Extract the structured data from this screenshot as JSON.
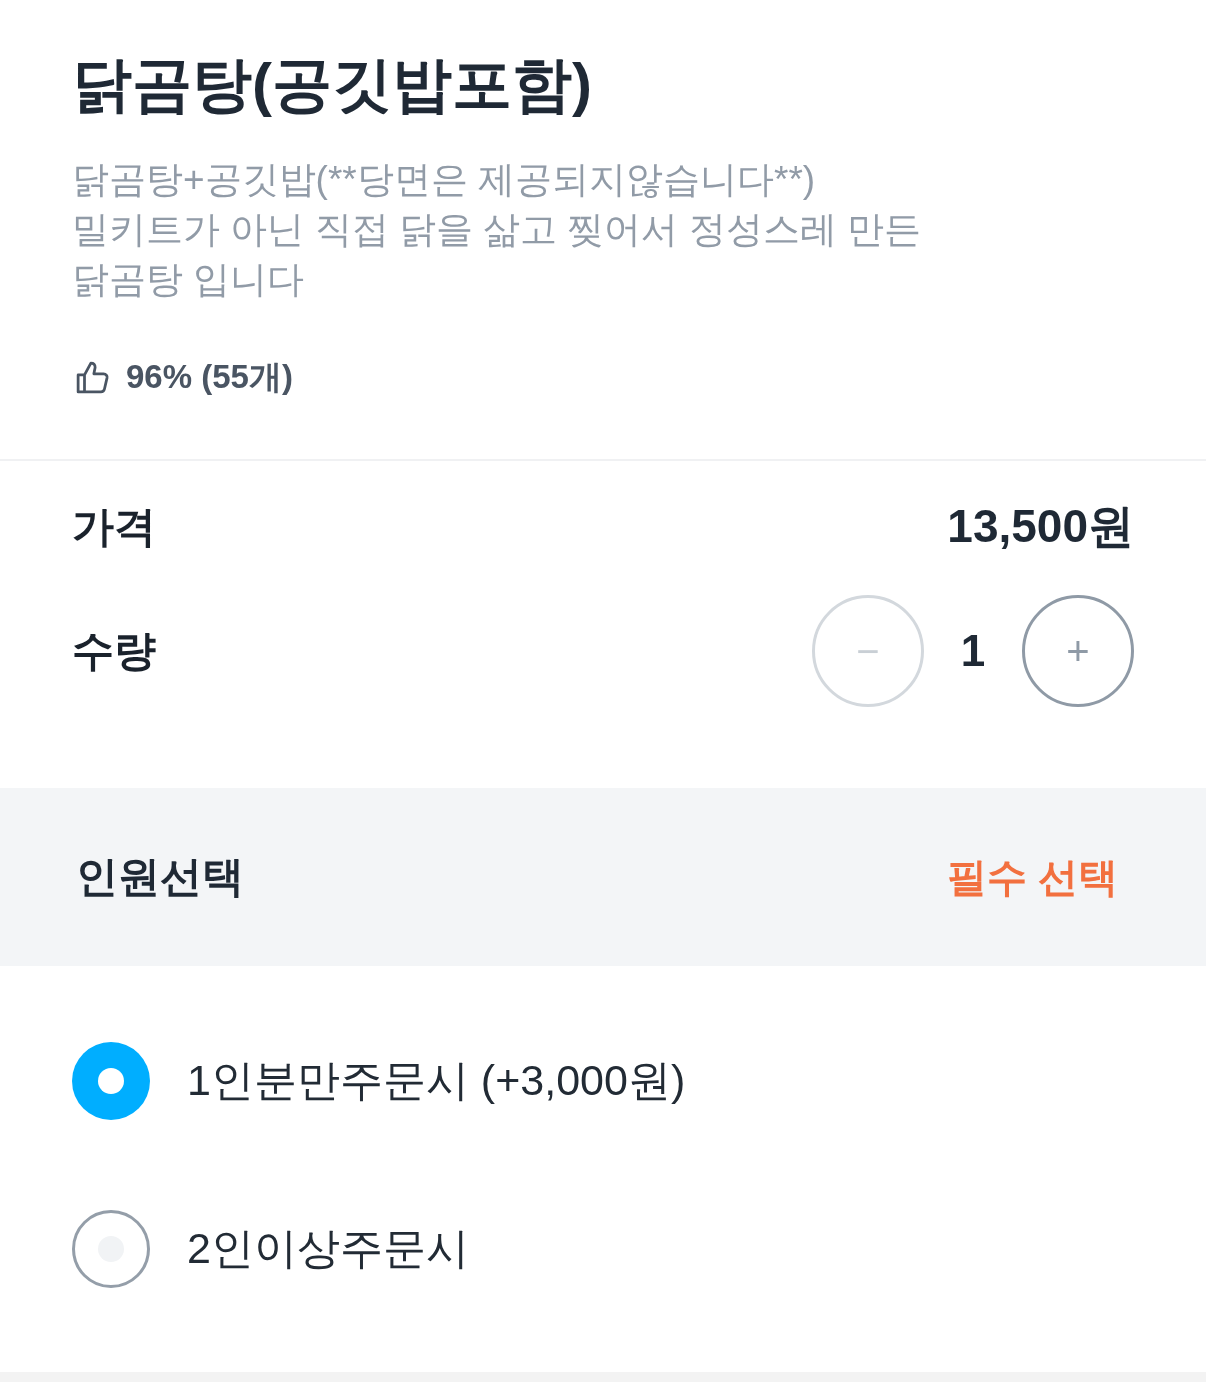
{
  "product": {
    "title": "닭곰탕(공깃밥포함)",
    "description": "닭곰탕+공깃밥(**당면은 제공되지않습니다**)\n밀키트가 아닌 직접 닭을 삶고 찢어서 정성스레 만든\n닭곰탕 입니다",
    "rating": "96% (55개)"
  },
  "price": {
    "label": "가격",
    "value": "13,500원"
  },
  "quantity": {
    "label": "수량",
    "value": "1",
    "decrement": {
      "label": "−",
      "disabled": true
    },
    "increment": {
      "label": "+",
      "disabled": false
    }
  },
  "option_group": {
    "title": "인원선택",
    "badge": "필수 선택",
    "options": [
      {
        "label": "1인분만주문시 (+3,000원)",
        "selected": true
      },
      {
        "label": "2인이상주문시",
        "selected": false
      }
    ]
  }
}
